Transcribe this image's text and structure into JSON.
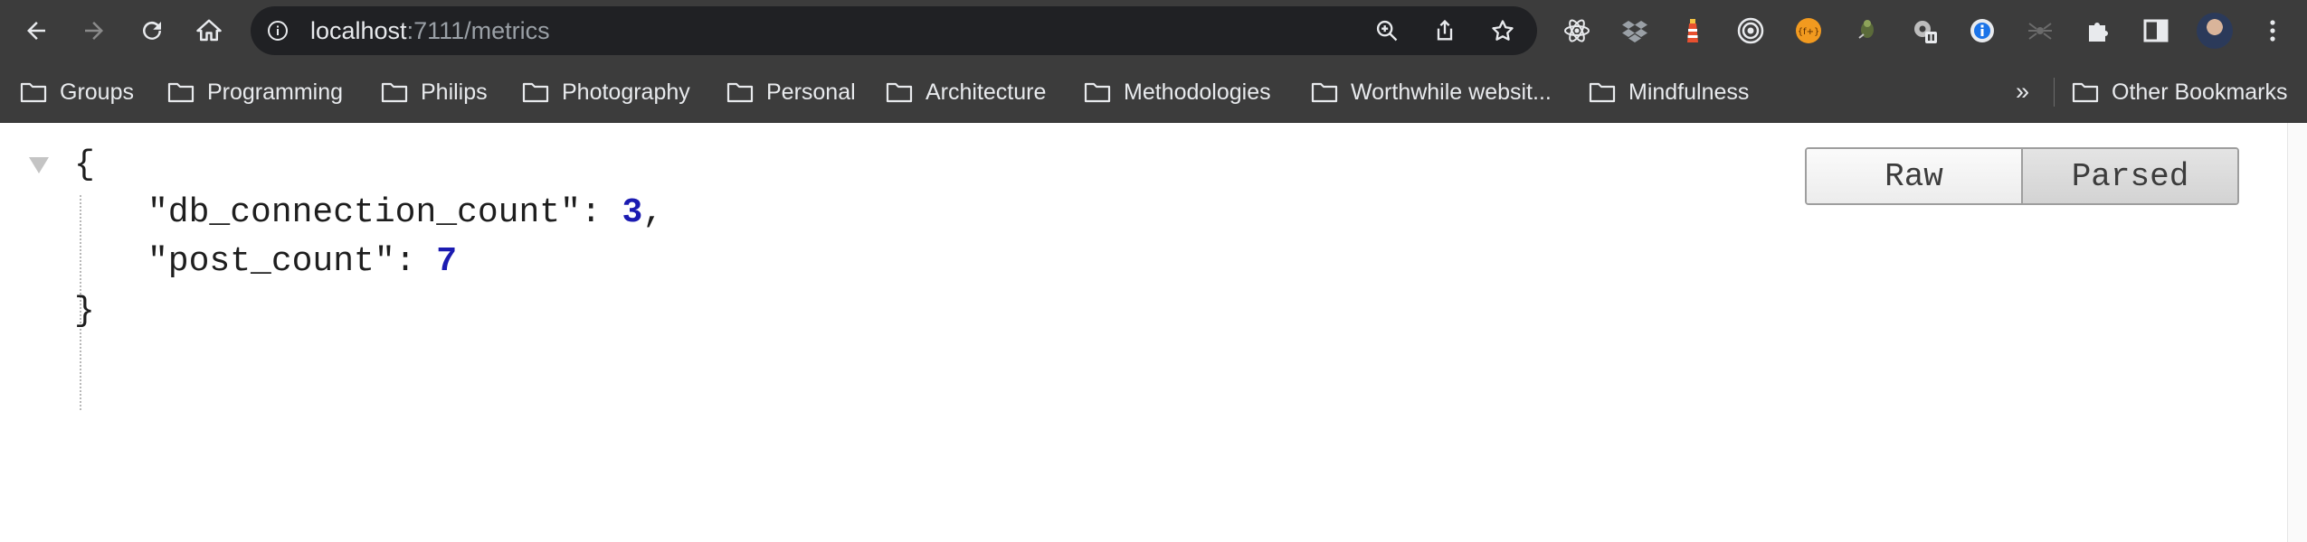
{
  "browser": {
    "url_host": "localhost",
    "url_rest": ":7111/metrics",
    "extensions": [
      "react-devtools-icon",
      "dropbox-icon",
      "lighthouse-icon",
      "target-icon",
      "formula-icon",
      "bug-icon",
      "gear-badge-icon",
      "info-icon",
      "spider-icon",
      "puzzle-icon",
      "sidebar-icon",
      "profile-avatar",
      "more-vert-icon"
    ]
  },
  "bookmarks": {
    "items": [
      {
        "label": "Groups"
      },
      {
        "label": "Programming"
      },
      {
        "label": "Philips"
      },
      {
        "label": "Photography"
      },
      {
        "label": "Personal"
      },
      {
        "label": "Architecture"
      },
      {
        "label": "Methodologies"
      },
      {
        "label": "Worthwhile websit..."
      },
      {
        "label": "Mindfulness"
      }
    ],
    "overflow": "»",
    "other": "Other Bookmarks"
  },
  "json_viewer": {
    "open_brace": "{",
    "close_brace": "}",
    "entries": [
      {
        "key": "\"db_connection_count\"",
        "colon": ": ",
        "value": "3",
        "trail": ","
      },
      {
        "key": "\"post_count\"",
        "colon": ": ",
        "value": "7",
        "trail": ""
      }
    ],
    "raw_label": "Raw",
    "parsed_label": "Parsed",
    "active_view": "Parsed"
  },
  "colors": {
    "toolbar_bg": "#3c3c3c",
    "omnibox_bg": "#202124",
    "number": "#1b1bb1"
  }
}
